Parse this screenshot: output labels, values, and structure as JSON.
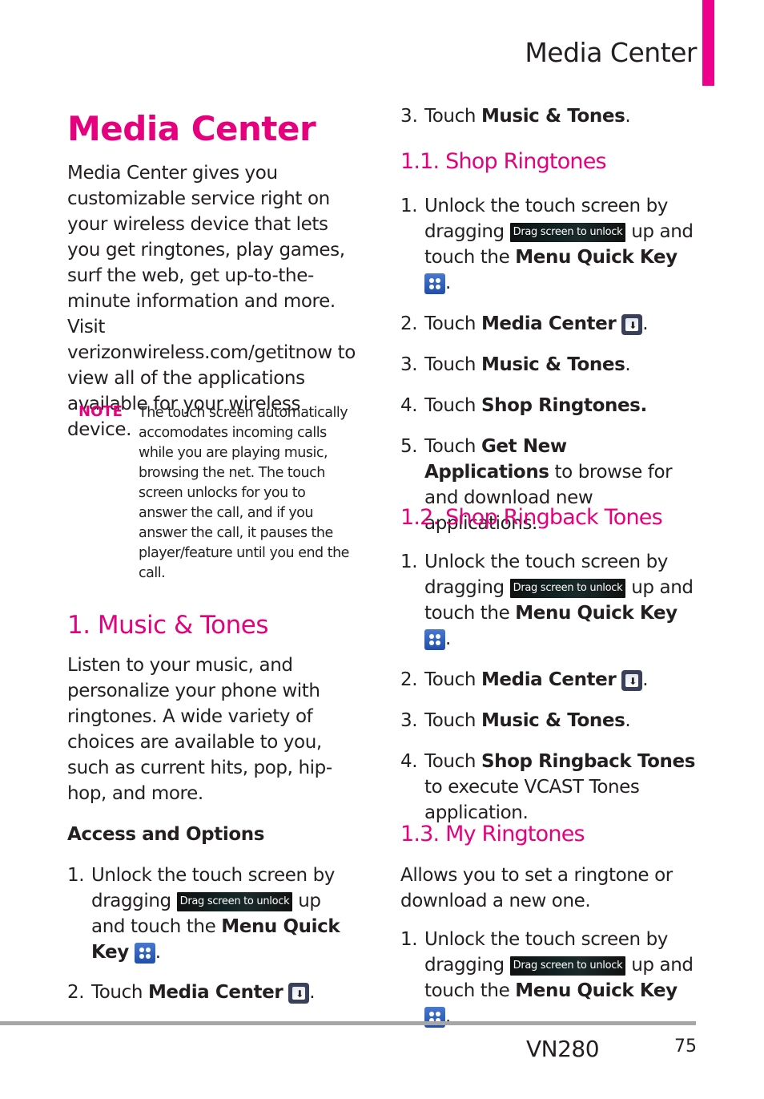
{
  "header": {
    "running_head": "Media Center",
    "accent_color": "#e5007e"
  },
  "page_title": "Media Center",
  "intro": "Media Center gives you customizable service right on your wireless device that lets you get ringtones, play games, surf the web, get up-to-the-minute information and more. Visit verizonwireless.com/getitnow to view all of the applications available for your wireless device.",
  "note": {
    "label": "NOTE",
    "text": "The touch screen automatically accomodates incoming calls while you are playing music, browsing the net. The touch screen unlocks for you to answer the call, and if you answer the call, it pauses the player/feature until you end the call."
  },
  "common": {
    "drag_label": "Drag screen to unlock",
    "unlock_prefix": "Unlock the touch screen by dragging",
    "up_and": "up and touch the",
    "menu_quick_key": "Menu Quick Key",
    "touch": "Touch",
    "media_center": "Media Center",
    "music_tones": "Music & Tones",
    "period": "."
  },
  "section1": {
    "heading": "1. Music & Tones",
    "body": "Listen to your music, and personalize your phone with ringtones. A wide variety of choices are available to you, such as current hits, pop, hip-hop, and more.",
    "subheading": "Access and Options",
    "steps_nums": [
      "1.",
      "2.",
      "3."
    ]
  },
  "section1_1": {
    "heading": "1.1. Shop Ringtones",
    "steps_nums": [
      "1.",
      "2.",
      "3.",
      "4.",
      "5."
    ],
    "step4_bold": "Shop Ringtones.",
    "step5_bold": "Get New Applications",
    "step5_rest": "to browse for and download new applications."
  },
  "section1_2": {
    "heading": "1.2. Shop Ringback Tones",
    "steps_nums": [
      "1.",
      "2.",
      "3.",
      "4."
    ],
    "step4_bold": "Shop Ringback Tones",
    "step4_rest": "to execute VCAST Tones application."
  },
  "section1_3": {
    "heading": "1.3. My Ringtones",
    "body": "Allows you to set a ringtone or download a new one.",
    "steps_nums": [
      "1."
    ]
  },
  "footer": {
    "model": "VN280",
    "page_number": "75"
  }
}
